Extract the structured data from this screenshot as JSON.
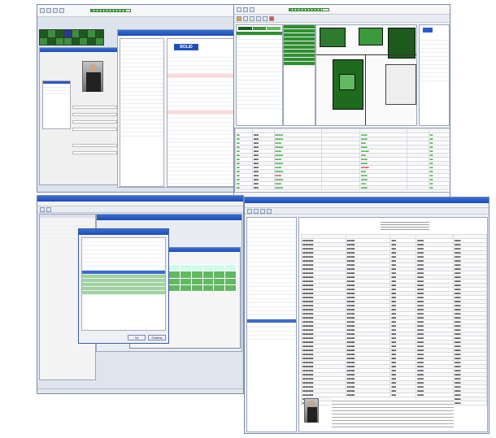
{
  "topleft_app": {
    "progress_fraction": 0.9,
    "panel_logo": "BOLID"
  },
  "topright_app": {
    "progress_fraction": 0.85
  },
  "event_log": {
    "rows": 18
  },
  "bottomleft_app": {
    "dialog_ok": "Ок",
    "dialog_cancel": "Отмена"
  },
  "colors": {
    "accent": "#1b4cb3",
    "green": "#3e8f3e",
    "dark_green": "#1e5a1e",
    "red": "#d03030"
  }
}
